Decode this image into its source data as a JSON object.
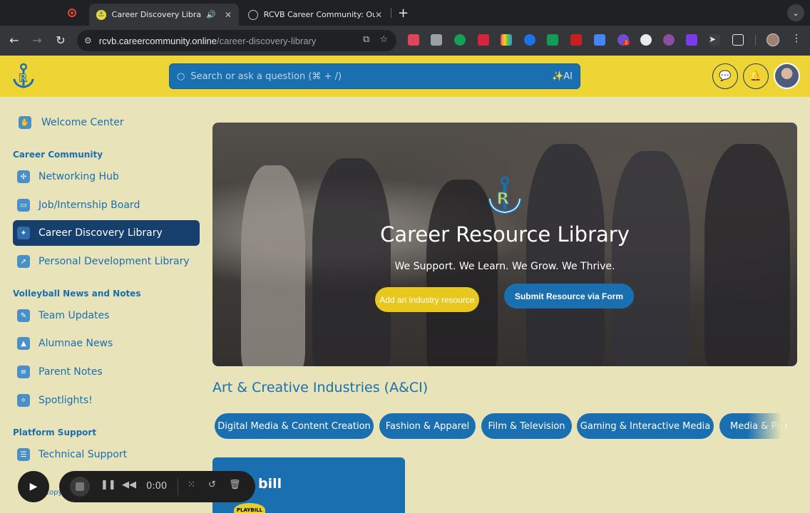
{
  "browser": {
    "tabs": [
      {
        "title": "Career Discovery Library",
        "active": true
      },
      {
        "title": "RCVB Career Community: Ou",
        "active": false
      }
    ],
    "url_domain": "rcvb.careercommunity.online",
    "url_path": "/career-discovery-library",
    "extension_badge": "2"
  },
  "header": {
    "search_placeholder": "Search or ask a question (⌘ + /)",
    "ai_label": "✨AI"
  },
  "sidebar": {
    "welcome": "Welcome Center",
    "sections": [
      {
        "heading": "Career Community",
        "items": [
          "Networking Hub",
          "Job/Internship Board",
          "Career Discovery Library",
          "Personal Development Library"
        ]
      },
      {
        "heading": "Volleyball News and Notes",
        "items": [
          "Team Updates",
          "Alumnae News",
          "Parent Notes",
          "Spotlights!"
        ]
      },
      {
        "heading": "Platform Support",
        "items": [
          "Technical Support"
        ]
      }
    ],
    "active_item": "Career Discovery Library",
    "copyright": "Copyright"
  },
  "hero": {
    "title": "Career Resource Library",
    "subtitle": "We Support. We Learn. We Grow. We Thrive.",
    "button_primary": "Add an industry resource",
    "button_secondary": "Submit Resource via Form"
  },
  "section": {
    "title": "Art & Creative Industries (A&CI)",
    "chips": [
      "Digital Media & Content Creation",
      "Fashion & Apparel",
      "Film & Television",
      "Gaming & Interactive Media",
      "Media & Publishing"
    ]
  },
  "card": {
    "title": "bill",
    "badge": "PLAYBILL"
  },
  "recorder": {
    "time": "0:00"
  },
  "colors": {
    "header_yellow": "#eed535",
    "brand_blue": "#1a6fb1",
    "active_navy": "#173f6e",
    "page_bg": "#e8e3b8"
  }
}
